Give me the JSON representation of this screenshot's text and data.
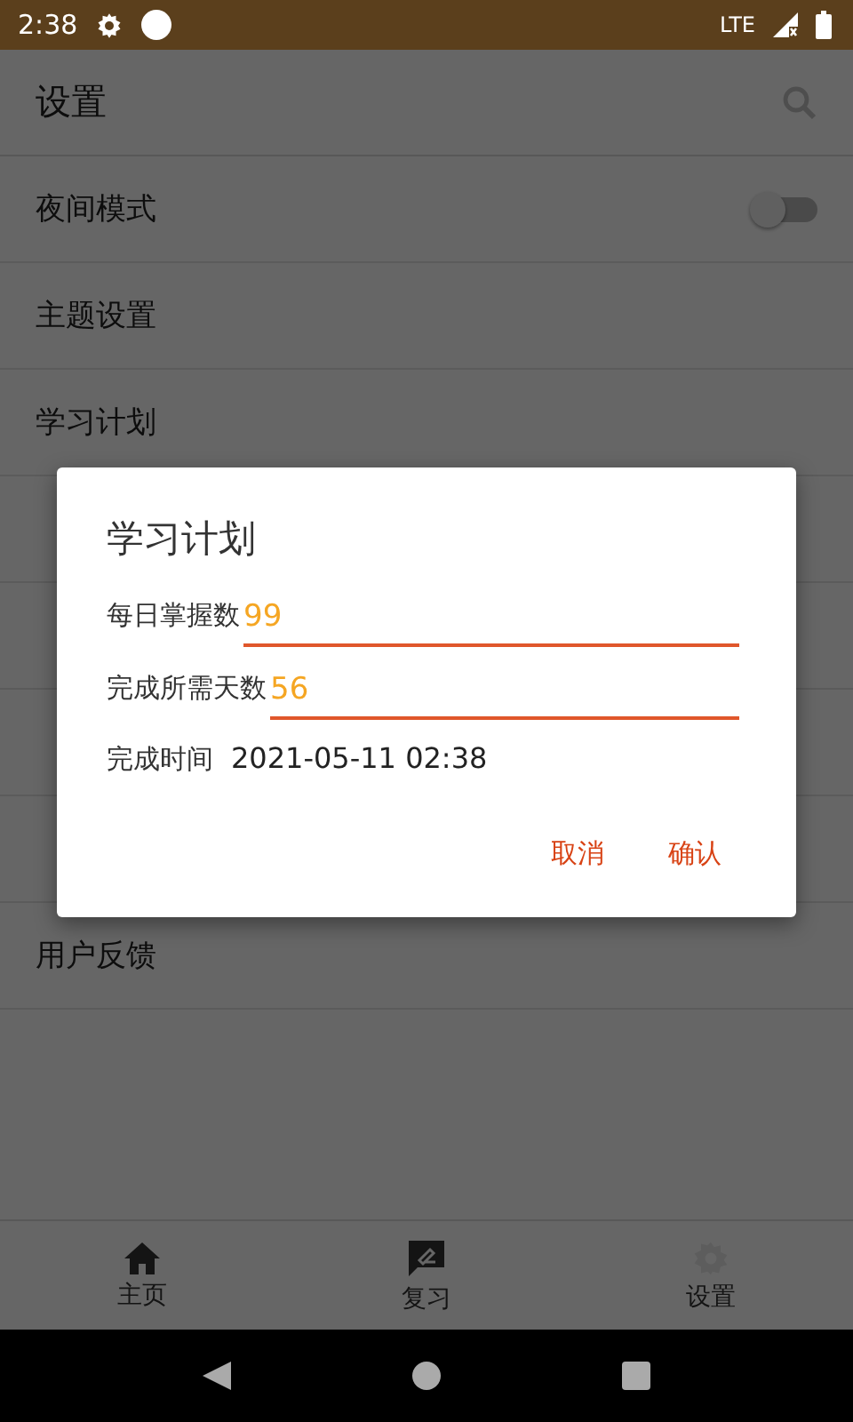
{
  "status_bar": {
    "time": "2:38",
    "network": "LTE"
  },
  "app_bar": {
    "title": "设置"
  },
  "settings": [
    {
      "label": "夜间模式",
      "kind": "toggle",
      "on": false
    },
    {
      "label": "主题设置",
      "kind": "plain"
    },
    {
      "label": "学习计划",
      "kind": "plain"
    },
    {
      "kind": "covered"
    },
    {
      "kind": "covered"
    },
    {
      "kind": "covered"
    },
    {
      "kind": "covered"
    },
    {
      "label": "用户反馈",
      "kind": "plain"
    }
  ],
  "bottom_nav": [
    {
      "label": "主页",
      "selected": false
    },
    {
      "label": "复习",
      "selected": false
    },
    {
      "label": "设置",
      "selected": true
    }
  ],
  "dialog": {
    "title": "学习计划",
    "fields": [
      {
        "label": "每日掌握数",
        "value": "99"
      },
      {
        "label": "完成所需天数",
        "value": "56"
      }
    ],
    "result_label": "完成时间",
    "result_value": "2021-05-11 02:38",
    "buttons": [
      "取消",
      "确认"
    ]
  }
}
